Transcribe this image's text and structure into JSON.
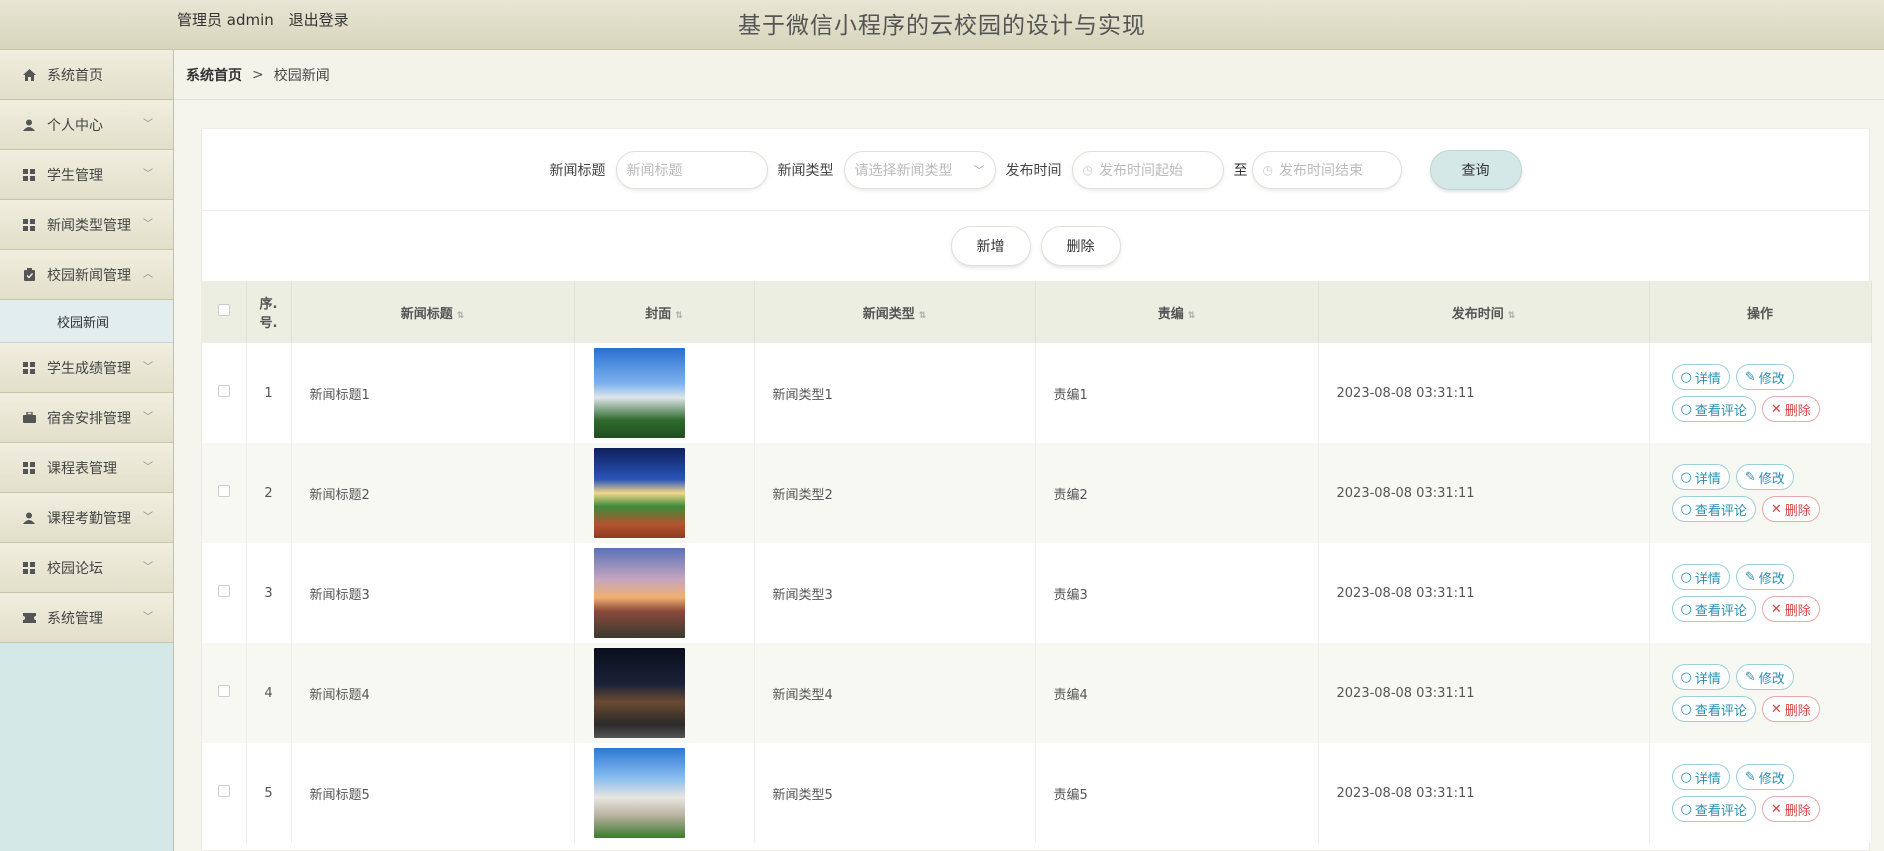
{
  "header": {
    "user_role": "管理员 admin",
    "logout": "退出登录",
    "title": "基于微信小程序的云校园的设计与实现"
  },
  "sidebar": {
    "items": [
      {
        "label": "系统首页",
        "icon": "home-icon"
      },
      {
        "label": "个人中心",
        "icon": "person-icon"
      },
      {
        "label": "学生管理",
        "icon": "grid-icon"
      },
      {
        "label": "新闻类型管理",
        "icon": "grid-icon"
      },
      {
        "label": "校园新闻管理",
        "icon": "clipboard-icon"
      },
      {
        "label": "学生成绩管理",
        "icon": "grid-icon"
      },
      {
        "label": "宿舍安排管理",
        "icon": "briefcase-icon"
      },
      {
        "label": "课程表管理",
        "icon": "grid-icon"
      },
      {
        "label": "课程考勤管理",
        "icon": "person-icon"
      },
      {
        "label": "校园论坛",
        "icon": "grid-icon"
      },
      {
        "label": "系统管理",
        "icon": "ticket-icon"
      }
    ],
    "sub_item": "校园新闻"
  },
  "breadcrumb": {
    "home": "系统首页",
    "separator": ">",
    "current": "校园新闻"
  },
  "search": {
    "title_label": "新闻标题",
    "title_placeholder": "新闻标题",
    "type_label": "新闻类型",
    "type_placeholder": "请选择新闻类型",
    "time_label": "发布时间",
    "time_start_placeholder": "发布时间起始",
    "to": "至",
    "time_end_placeholder": "发布时间结束",
    "query_button": "查询"
  },
  "actions": {
    "add": "新增",
    "delete": "删除"
  },
  "table": {
    "headers": {
      "index": "序.\n号.",
      "title": "新闻标题",
      "cover": "封面",
      "type": "新闻类型",
      "editor": "责编",
      "time": "发布时间",
      "ops": "操作"
    },
    "op_labels": {
      "detail": "详情",
      "edit": "修改",
      "comments": "查看评论",
      "delete": "删除"
    },
    "rows": [
      {
        "index": "1",
        "title": "新闻标题1",
        "type": "新闻类型1",
        "editor": "责编1",
        "time": "2023-08-08 03:31:11"
      },
      {
        "index": "2",
        "title": "新闻标题2",
        "type": "新闻类型2",
        "editor": "责编2",
        "time": "2023-08-08 03:31:11"
      },
      {
        "index": "3",
        "title": "新闻标题3",
        "type": "新闻类型3",
        "editor": "责编3",
        "time": "2023-08-08 03:31:11"
      },
      {
        "index": "4",
        "title": "新闻标题4",
        "type": "新闻类型4",
        "editor": "责编4",
        "time": "2023-08-08 03:31:11"
      },
      {
        "index": "5",
        "title": "新闻标题5",
        "type": "新闻类型5",
        "editor": "责编5",
        "time": "2023-08-08 03:31:11"
      }
    ]
  }
}
